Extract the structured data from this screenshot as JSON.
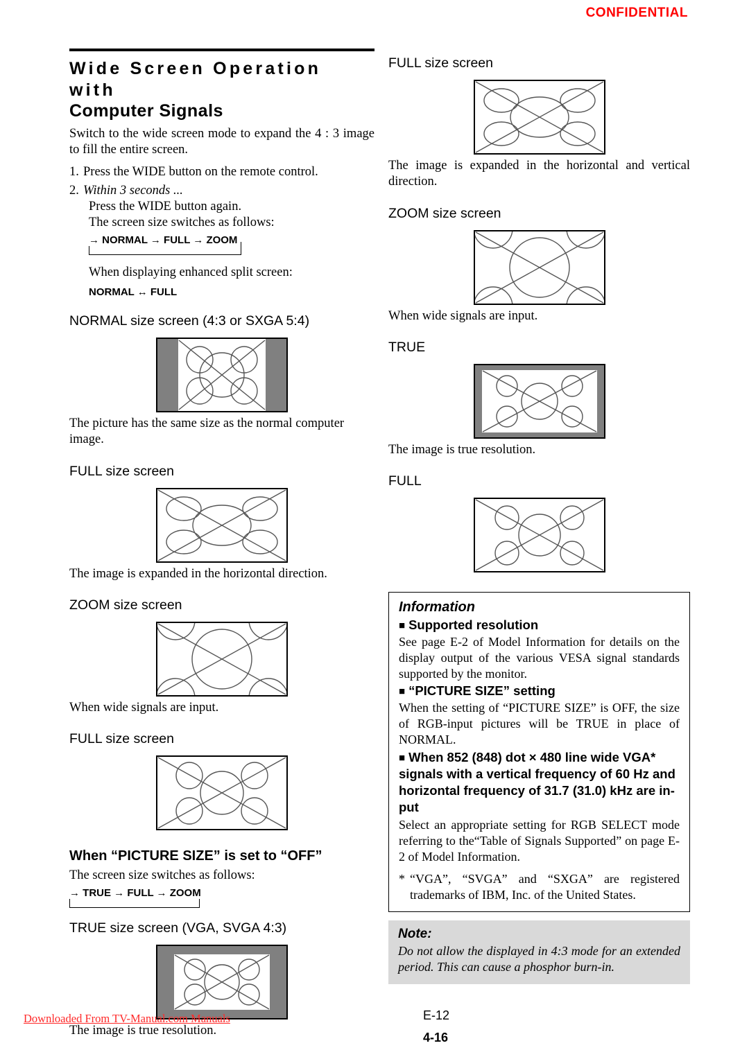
{
  "header": {
    "confidential": "CONFIDENTIAL"
  },
  "left": {
    "title_line1": "Wide Screen Operation with",
    "title_line2": "Computer Signals",
    "intro": "Switch to the wide screen mode to expand the 4 : 3 image to fill the entire screen.",
    "step1_num": "1.",
    "step1": "Press the WIDE button on the remote control.",
    "step2_num": "2.",
    "step2": "Within 3 seconds ...",
    "step2_line1": "Press the WIDE button again.",
    "step2_line2": "The screen size switches as follows:",
    "cycle1": "→ NORMAL → FULL → ZOOM",
    "split_note": "When displaying enhanced split screen:",
    "cycle2": "NORMAL ↔ FULL",
    "cap_normal": "NORMAL size screen (4:3 or SXGA 5:4)",
    "desc_normal": "The picture has the same size as the normal computer image.",
    "cap_full1": "FULL size screen",
    "desc_full1": "The image is expanded in the horizontal direction.",
    "cap_zoom": "ZOOM size screen",
    "desc_zoom": "When wide signals are input.",
    "cap_full2": "FULL size screen",
    "heading_off": "When “PICTURE SIZE” is set to “OFF”",
    "off_line": "The screen size switches as follows:",
    "cycle3": "→ TRUE → FULL → ZOOM",
    "cap_true": "TRUE size screen (VGA, SVGA 4:3)",
    "desc_true": "The image is true resolution."
  },
  "right": {
    "cap_full1": "FULL size screen",
    "desc_full1": "The image is expanded in the horizontal and vertical direction.",
    "cap_zoom": "ZOOM size screen",
    "desc_zoom": "When wide signals are input.",
    "cap_true": "TRUE",
    "desc_true": "The image is true resolution.",
    "cap_full2": "FULL",
    "info": {
      "title": "Information",
      "head1": "Supported resolution",
      "p1": "See page E-2 of Model Information for details on the display output of the various VESA signal standards supported by the monitor.",
      "head2": "“PICTURE SIZE” setting",
      "p2": "When the setting of “PICTURE SIZE” is OFF, the size of RGB-input pictures will be TRUE in place of NORMAL.",
      "head3": "When 852 (848) dot × 480 line wide VGA* signals with a vertical frequency of 60 Hz and horizontal frequency of 31.7 (31.0) kHz are in-put",
      "p3": "Select an appropriate setting for RGB SELECT mode referring to the“Table of Signals Supported” on page E-2 of Model Information.",
      "star": "*",
      "footnote": "“VGA”, “SVGA” and “SXGA” are registered trademarks of IBM, Inc. of the United States.",
      "bullet": "■"
    },
    "note": {
      "title": "Note:",
      "text": "Do not allow the displayed in 4:3 mode for an extended period. This can cause a phosphor burn-in."
    }
  },
  "footer": {
    "watermark": "Downloaded From TV-Manual.com Manuals",
    "page_e": "E-12",
    "page_n": "4-16"
  },
  "colors": {
    "confidential": "#ff0000",
    "watermark": "#ff2a2a",
    "mask_gray": "#808080",
    "note_bg": "#d9d9d9"
  }
}
